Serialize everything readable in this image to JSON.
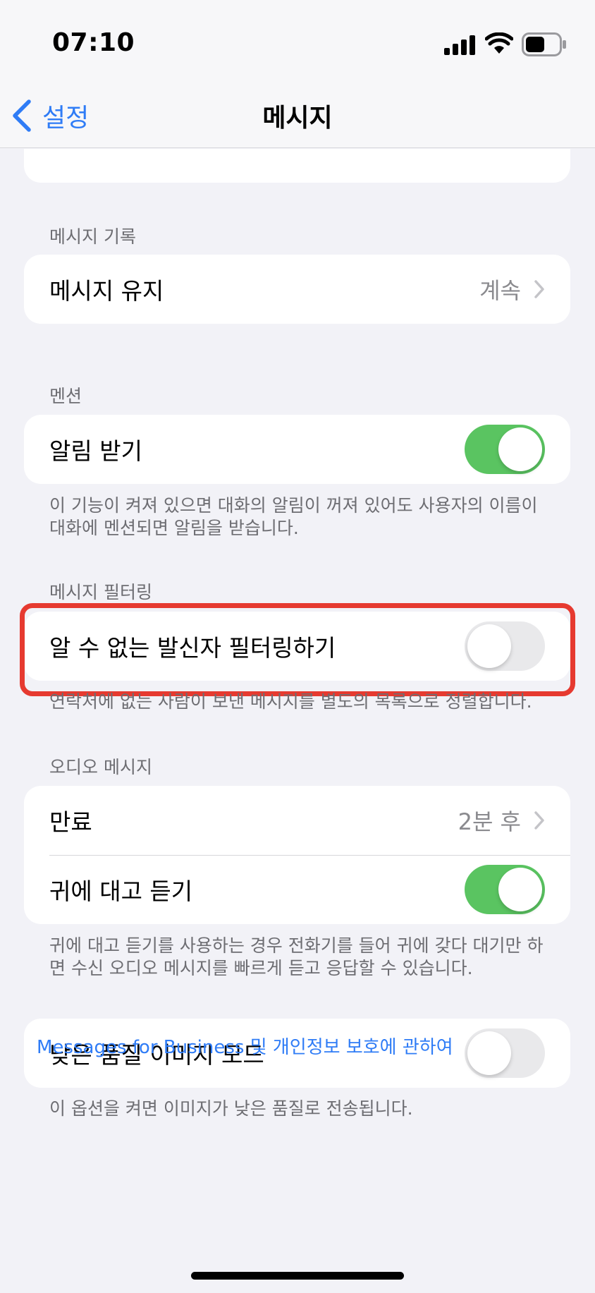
{
  "status_bar": {
    "time": "07:10",
    "icons": [
      "signal-icon",
      "wifi-icon",
      "battery-icon"
    ]
  },
  "nav": {
    "back_label": "설정",
    "title": "메시지"
  },
  "sections": {
    "history": {
      "header": "메시지 기록",
      "keep_messages": {
        "label": "메시지 유지",
        "value": "계속"
      }
    },
    "mentions": {
      "header": "멘션",
      "notify_me": {
        "label": "알림 받기",
        "enabled": true
      },
      "footer": "이 기능이 켜져 있으면 대화의 알림이 꺼져 있어도 사용자의 이름이 대화에 멘션되면 알림을 받습니다."
    },
    "filtering": {
      "header": "메시지 필터링",
      "filter_unknown": {
        "label": "알 수 없는 발신자 필터링하기",
        "enabled": false
      },
      "footer": "연락처에 없는 사람이 보낸 메시지를 별도의 목록으로 정렬합니다."
    },
    "audio": {
      "header": "오디오 메시지",
      "expire": {
        "label": "만료",
        "value": "2분 후"
      },
      "raise_to_listen": {
        "label": "귀에 대고 듣기",
        "enabled": true
      },
      "footer": "귀에 대고 듣기를 사용하는 경우 전화기를 들어 귀에 갖다 대기만 하면 수신 오디오 메시지를 빠르게 듣고 응답할 수 있습니다."
    },
    "low_quality": {
      "image_mode": {
        "label": "낮은 품질 이미지 모드",
        "enabled": false
      },
      "footer": "이 옵션을 켜면 이미지가 낮은 품질로 전송됩니다."
    }
  },
  "business_link": "Messages for Business 및 개인정보 보호에 관하여",
  "colors": {
    "accent": "#2f7cf6",
    "toggle_on": "#5ac461",
    "highlight": "#e63a30"
  }
}
